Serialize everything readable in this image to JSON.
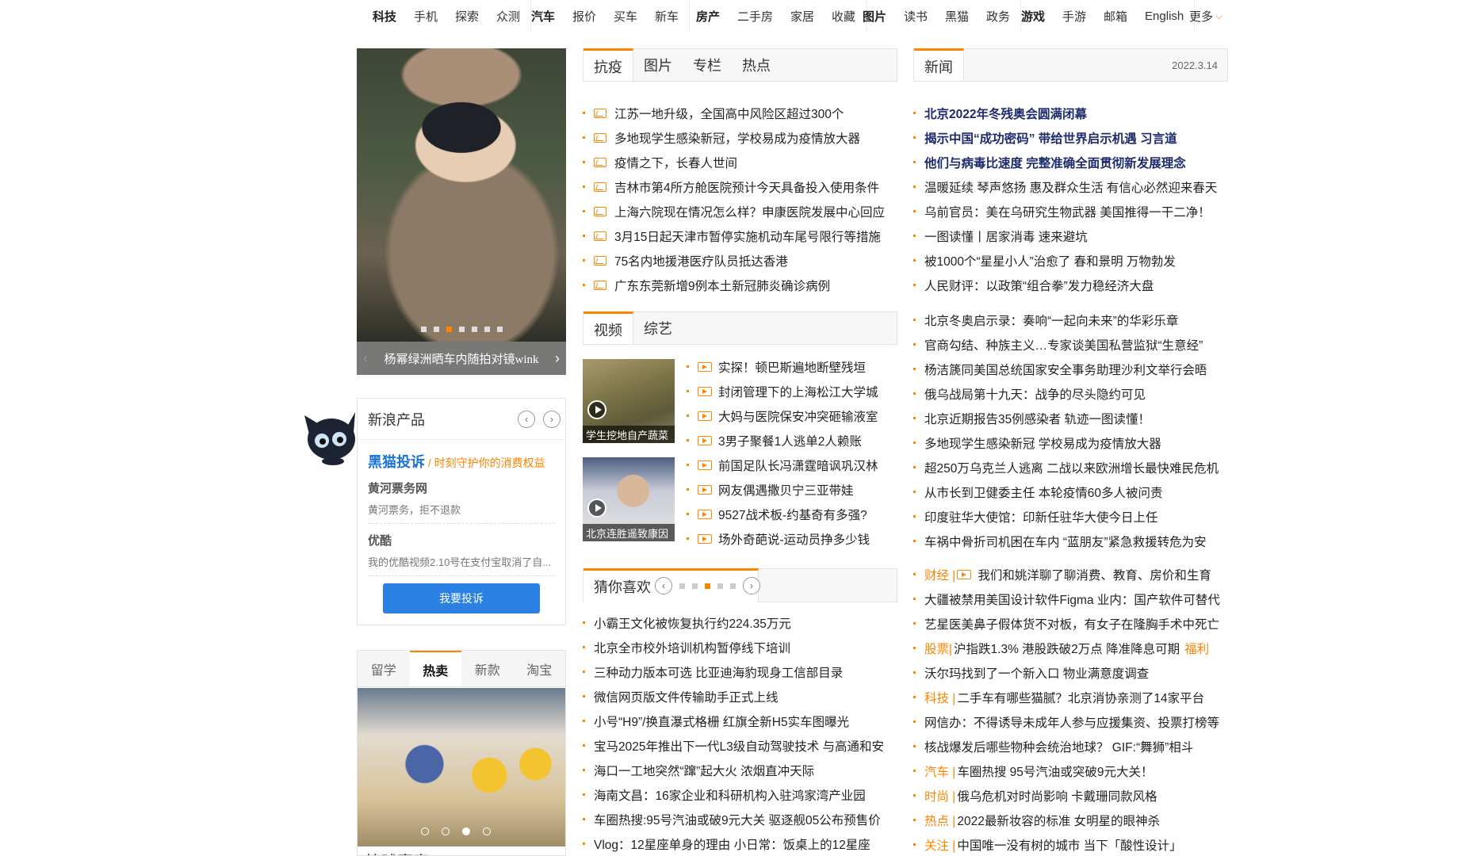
{
  "topnav": {
    "groups": [
      {
        "items": [
          "科技",
          "手机",
          "探索",
          "众测"
        ]
      },
      {
        "items": [
          "汽车",
          "报价",
          "买车",
          "新车"
        ]
      },
      {
        "items": [
          "房产",
          "二手房",
          "家居",
          "收藏"
        ]
      },
      {
        "items": [
          "图片",
          "读书",
          "黑猫",
          "政务"
        ]
      },
      {
        "items": [
          "游戏",
          "手游",
          "邮箱",
          "English"
        ]
      }
    ],
    "more": "更多"
  },
  "slideshow": {
    "caption": "杨幂绿洲晒车内随拍对镜wink",
    "active_dot": 2,
    "dot_count": 7
  },
  "products": {
    "title": "新浪产品",
    "brand": "黑猫投诉",
    "brand_sep": " / ",
    "brand_tagline": "时刻守护你的消费权益",
    "items": [
      {
        "title": "黄河票务网",
        "desc": "黄河票务，拒不退款"
      },
      {
        "title": "优酷",
        "desc": "我的优酷视频2.10号在支付宝取消了自..."
      }
    ],
    "cta": "我要投诉"
  },
  "shop": {
    "tabs": [
      "留学",
      "热卖",
      "新款",
      "淘宝"
    ],
    "active_tab": 1,
    "caption": "篮球赛事"
  },
  "col2": {
    "tabs1": [
      "抗疫",
      "图片",
      "专栏",
      "热点"
    ],
    "list1": [
      "江苏一地升级，全国高中风险区超过300个",
      "多地现学生感染新冠，学校易成为疫情放大器",
      "疫情之下，长春人世间",
      "吉林市第4所方舱医院预计今天具备投入使用条件",
      "上海六院现在情况怎么样？申康医院发展中心回应",
      "3月15日起天津市暂停实施机动车尾号限行等措施",
      "75名内地援港医疗队员抵达香港",
      "广东东莞新增9例本土新冠肺炎确诊病例"
    ],
    "tabs2": [
      "视频",
      "综艺"
    ],
    "video_thumbs": [
      "学生挖地自产蔬菜",
      "北京连胜遥致康因"
    ],
    "list2": [
      "实探！顿巴斯遍地断壁残垣",
      "封闭管理下的上海松江大学城",
      "大妈与医院保安冲突砸输液室",
      "3男子聚餐1人逃单2人赖账",
      "前国足队长冯潇霆暗讽巩汉林",
      "网友偶遇撒贝宁三亚带娃",
      "9527战术板-约基奇有多强?",
      "场外奇葩说-运动员挣多少钱"
    ],
    "guess_title": "猜你喜欢",
    "list3": [
      "小霸王文化被恢复执行约224.35万元",
      "北京全市校外培训机构暂停线下培训",
      "三种动力版本可选 比亚迪海豹现身工信部目录",
      "微信网页版文件传输助手正式上线",
      "小号“H9”/换直瀑式格栅 红旗全新H5实车图曝光",
      "宝马2025年推出下一代L3级自动驾驶技术 与高通和安",
      "海口一工地突然“蹿”起大火 浓烟直冲天际",
      "海南文昌：16家企业和科研机构入驻鸿家湾产业园",
      "车圈热搜:95号汽油或破9元大关 驱逐舰05公布预售价",
      "Vlog：12星座单身的理由 小日常：饭桌上的12星座"
    ]
  },
  "col3": {
    "tab": "新闻",
    "date": "2022.3.14",
    "list_a": [
      {
        "text": "北京2022年冬残奥会圆满闭幕",
        "bold": true
      },
      {
        "text": "揭示中国“成功密码” 带给世界启示机遇 习言道",
        "bold": true
      },
      {
        "text": "他们与病毒比速度 完整准确全面贯彻新发展理念",
        "bold": true
      },
      {
        "text": "温暖延续 琴声悠扬 惠及群众生活 有信心必然迎来春天",
        "bold": false
      },
      {
        "text": "乌前官员：美在乌研究生物武器 美国推得一干二净！",
        "bold": false
      },
      {
        "text": "一图读懂丨居家消毒 速来避坑",
        "bold": false
      },
      {
        "text": "被1000个“星星小人”治愈了 春和景明 万物勃发",
        "bold": false
      },
      {
        "text": "人民财评：以政策“组合拳”发力稳经济大盘",
        "bold": false
      }
    ],
    "list_b": [
      "北京冬奥启示录：奏响“一起向未来”的华彩乐章",
      "官商勾结、种族主义…专家谈美国私营监狱“生意经”",
      "杨洁篪同美国总统国家安全事务助理沙利文举行会晤",
      "俄乌战局第十九天：战争的尽头隐约可见",
      "北京近期报告35例感染者 轨迹一图读懂！",
      "多地现学生感染新冠 学校易成为疫情放大器",
      "超250万乌克兰人逃离 二战以来欧洲增长最快难民危机",
      "从市长到卫健委主任 本轮疫情60多人被问责",
      "印度驻华大使馆：印新任驻华大使今日上任",
      "车祸中骨折司机困在车内 “蓝朋友”紧急救援转危为安"
    ],
    "list_c": [
      {
        "cat": "财经 |",
        "video": true,
        "text": "我们和姚洋聊了聊消费、教育、房价和生育",
        "tail": ""
      },
      {
        "cat": "",
        "video": false,
        "text": "大疆被禁用美国设计软件Figma 业内：国产软件可替代",
        "tail": ""
      },
      {
        "cat": "",
        "video": false,
        "text": "艺星医美鼻子假体货不对板，有女子在隆胸手术中死亡",
        "tail": ""
      },
      {
        "cat": "股票|",
        "video": false,
        "text": "沪指跌1.3% 港股跌破2万点 降准降息可期",
        "tail": "福利"
      },
      {
        "cat": "",
        "video": false,
        "text": "沃尔玛找到了一个新入口 物业满意度调查",
        "tail": ""
      },
      {
        "cat": "科技 |",
        "video": false,
        "text": "二手车有哪些猫腻？北京消协亲测了14家平台",
        "tail": ""
      },
      {
        "cat": "",
        "video": false,
        "text": "网信办：不得诱导未成年人参与应援集资、投票打榜等",
        "tail": ""
      },
      {
        "cat": "",
        "video": false,
        "text": "核战爆发后哪些物种会统治地球？ GIF:“舞狮”相斗",
        "tail": ""
      },
      {
        "cat": "汽车 |",
        "video": false,
        "text": "车圈热搜 95号汽油或突破9元大关！",
        "tail": ""
      },
      {
        "cat": "时尚 |",
        "video": false,
        "text": "俄乌危机对时尚影响 卡戴珊同款风格",
        "tail": ""
      },
      {
        "cat": "热点 |",
        "video": false,
        "text": "2022最新妆容的标准 女明星的眼神杀",
        "tail": ""
      },
      {
        "cat": "关注 |",
        "video": false,
        "text": "中国唯一没有树的城市 当下「酸性设计」",
        "tail": ""
      }
    ]
  },
  "colors": {
    "accent": "#ff8400",
    "headline": "#1c2b6b",
    "button": "#2a80e3"
  }
}
